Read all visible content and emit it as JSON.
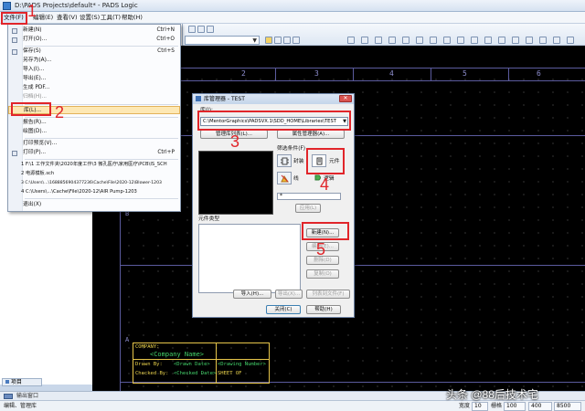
{
  "window": {
    "title": "D:\\PADS Projects\\default* - PADS Logic"
  },
  "menubar": {
    "items": [
      "文件(F)",
      "编辑(E)",
      "查看(V)",
      "设置(S)",
      "工具(T)",
      "帮助(H)"
    ]
  },
  "file_menu": {
    "items": [
      {
        "label": "新建(N)",
        "shortcut": "Ctrl+N"
      },
      {
        "label": "打开(O)...",
        "shortcut": "Ctrl+O"
      },
      {
        "label": "保存(S)",
        "shortcut": "Ctrl+S"
      },
      {
        "label": "另存为(A)...",
        "shortcut": ""
      },
      {
        "label": "导入(I)...",
        "shortcut": ""
      },
      {
        "label": "导出(E)...",
        "shortcut": ""
      },
      {
        "label": "生成 PDF...",
        "shortcut": ""
      },
      {
        "label": "归档(H)...",
        "shortcut": ""
      },
      {
        "label": "库(L)...",
        "shortcut": ""
      },
      {
        "label": "报告(R)...",
        "shortcut": ""
      },
      {
        "label": "绘图(D)...",
        "shortcut": ""
      },
      {
        "label": "打印预览(V)...",
        "shortcut": ""
      },
      {
        "label": "打印(P)...",
        "shortcut": "Ctrl+P"
      },
      {
        "label": "1 F:\\1  工作文件夹\\2020年度工作\\3 微孔医疗\\家用医疗\\PCB\\IS_SCH",
        "shortcut": ""
      },
      {
        "label": "2 电源模板.sch",
        "shortcut": ""
      },
      {
        "label": "3 C:\\Users\\...\\1688856904377236\\Cache\\File\\2020-12\\Blower-1203",
        "shortcut": ""
      },
      {
        "label": "4 C:\\Users\\...\\Cache\\File\\2020-12\\AIR Pump-1203",
        "shortcut": ""
      },
      {
        "label": "退出(X)",
        "shortcut": ""
      }
    ],
    "highlighted": "库(L)..."
  },
  "left_pane": {
    "tab_label": "项目"
  },
  "canvas": {
    "zones": [
      "2",
      "3",
      "4",
      "5",
      "6"
    ],
    "row_labels": [
      "B",
      "A"
    ],
    "titleblock": {
      "company": "COMPANY:",
      "company_name": "<Company Name>",
      "drawn_by": "Drawn By:",
      "checked_by": "Checked By:",
      "drawn_value": "<Drawn Date>",
      "checked_value": "<Checked Date>",
      "drawing_number": "<Drawing Number>",
      "sheet": "SHEET OF"
    }
  },
  "dialog": {
    "title": "库管理器 - TEST",
    "library_label": "库(I):",
    "library_path": "C:\\MentorGraphics\\PADSVX.1\\SDD_HOME\\Libraries\\TEST",
    "manage_list_button": "管理库列表(L)...",
    "attribute_manager_button": "属性管理器(A)...",
    "filter_label": "筛选条件(F)",
    "filter_types": [
      {
        "name": "封装",
        "icon": "decal-icon"
      },
      {
        "name": "元件",
        "icon": "part-icon"
      },
      {
        "name": "线",
        "icon": "line-icon"
      },
      {
        "name": "逻辑",
        "icon": "logic-icon"
      }
    ],
    "filter_value": "*",
    "apply_button": "应用(L)",
    "part_types_label": "元件类型",
    "buttons": {
      "new": "新建(N)...",
      "edit": "编辑(E)...",
      "delete": "删除(D)",
      "copy": "复制(O)",
      "import": "导入(H)...",
      "export": "导出(X)...",
      "list_to_file": "列表到文件(F)",
      "close": "关闭(C)",
      "help": "帮助(H)"
    }
  },
  "annotations": [
    "1",
    "2",
    "3",
    "4",
    "5"
  ],
  "status": {
    "output_window": "输出窗口",
    "left_text": "编辑、管理库",
    "width_label": "宽度",
    "width_value": "10",
    "grid_label": "栅格",
    "grid_value": "100",
    "x_value": "400",
    "y_value": "8500"
  },
  "watermark": "头条 @88后技术宅",
  "colors": {
    "annotation": "#e1252a",
    "canvas_bg": "#000000",
    "menu_highlight": "#fde8b4"
  }
}
